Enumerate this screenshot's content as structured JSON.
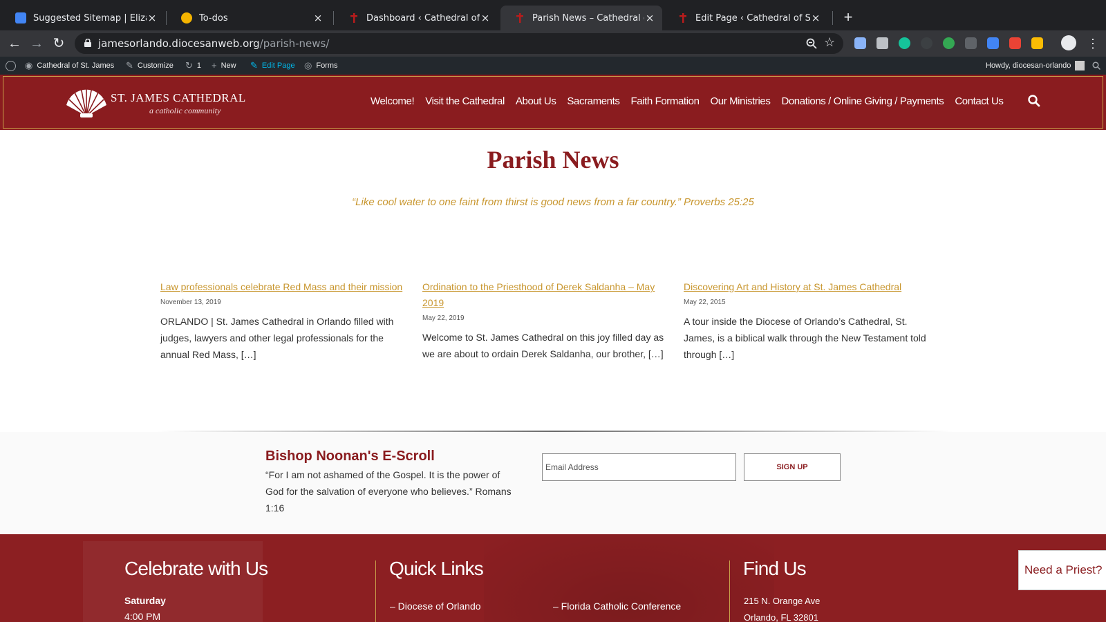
{
  "browser": {
    "tabs": [
      {
        "title": "Suggested Sitemap | Elizabeth",
        "favicon_color": "#4285f4",
        "active": false
      },
      {
        "title": "To-dos",
        "favicon_color": "#f4b400",
        "active": false
      },
      {
        "title": "Dashboard ‹ Cathedral of St. J",
        "favicon_color": "#b71c1c",
        "active": false
      },
      {
        "title": "Parish News – Cathedral of St.",
        "favicon_color": "#b71c1c",
        "active": true
      },
      {
        "title": "Edit Page ‹ Cathedral of St. Jam",
        "favicon_color": "#b71c1c",
        "active": false
      }
    ],
    "close_glyph": "×",
    "new_tab_glyph": "+",
    "url_domain": "jamesorlando.diocesanweb.org",
    "url_path": "/parish-news/",
    "icons": [
      "back-icon",
      "forward-icon",
      "reload-icon",
      "lock-icon",
      "zoom-icon",
      "star-icon",
      "menu-dots-icon"
    ]
  },
  "adminbar": {
    "site_name": "Cathedral of St. James",
    "customize": "Customize",
    "updates_count": "1",
    "new": "New",
    "edit_page": "Edit Page",
    "forms": "Forms",
    "howdy": "Howdy, diocesan-orlando"
  },
  "header": {
    "logo_title": "ST. JAMES CATHEDRAL",
    "logo_subtitle": "a catholic community",
    "nav": [
      "Welcome!",
      "Visit the Cathedral",
      "About Us",
      "Sacraments",
      "Faith Formation",
      "Our Ministries",
      "Donations / Online Giving / Payments",
      "Contact Us"
    ]
  },
  "page": {
    "title": "Parish News",
    "verse": "“Like cool water to one faint from thirst is good news from a far country.” Proverbs 25:25"
  },
  "posts": [
    {
      "title": "Law professionals celebrate Red Mass and their mission",
      "date": "November 13, 2019",
      "excerpt": "ORLANDO | St. James Cathedral in Orlando filled with judges, lawyers and other legal professionals for the annual Red Mass, […]"
    },
    {
      "title": "Ordination to the Priesthood of Derek Saldanha – May 2019",
      "date": "May 22, 2019",
      "excerpt": "Welcome to St. James Cathedral on this joy filled day as we are about to ordain Derek Saldanha, our brother, […]"
    },
    {
      "title": "Discovering Art and History at St. James Cathedral",
      "date": "May 22, 2015",
      "excerpt": "A tour inside the Diocese of Orlando’s Cathedral, St. James, is a biblical walk through the New Testament told through […]"
    }
  ],
  "escroll": {
    "title": "Bishop Noonan's E-Scroll",
    "text": "“For I am not ashamed of the Gospel. It is the power of God for the salvation of everyone who believes.” Romans 1:16",
    "email_placeholder": "Email Address",
    "signup_label": "SIGN UP"
  },
  "footer": {
    "celebrate": {
      "heading": "Celebrate with Us",
      "day": "Saturday",
      "time": "4:00 PM"
    },
    "quick_links": {
      "heading": "Quick Links",
      "links": [
        "– Diocese of Orlando",
        "– Florida Catholic Conference"
      ]
    },
    "find_us": {
      "heading": "Find Us",
      "address1": "215 N. Orange Ave",
      "address2": "Orlando, FL 32801"
    }
  },
  "floating": {
    "need_priest": "Need a Priest?"
  },
  "colors": {
    "brand_red": "#8a1c1f",
    "accent_gold": "#c8962e",
    "admin_dark": "#23282d"
  }
}
